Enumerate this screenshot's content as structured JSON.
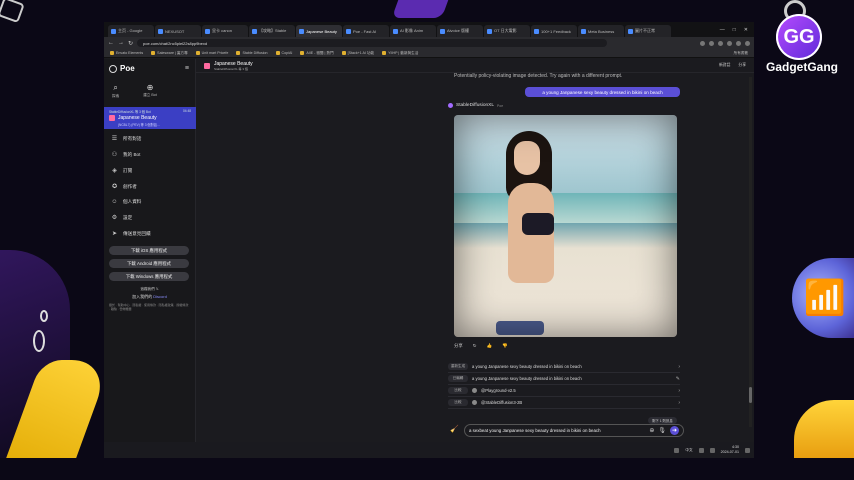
{
  "brand": {
    "logo_text": "GG",
    "name": "GadgetGang"
  },
  "browser": {
    "tabs": [
      {
        "label": "主页 - Google"
      },
      {
        "label": "NEXUSOT"
      },
      {
        "label": "显卡 canon"
      },
      {
        "label": "【攻略】Stable"
      },
      {
        "label": "Japanese Beauty",
        "active": true
      },
      {
        "label": "Poe - Fast AI"
      },
      {
        "label": "AI 影像 Anim"
      },
      {
        "label": "Aivoice 版權"
      },
      {
        "label": "OT 日大電影"
      },
      {
        "label": "100+1 Feedback"
      },
      {
        "label": "Meta Business"
      },
      {
        "label": "圖片不正常"
      }
    ],
    "window_controls": [
      "—",
      "□",
      "✕"
    ],
    "url": "poe.com/chat/2nc5plel22s8pp9bexd",
    "bookmarks": [
      "Envato Elements",
      "Salesware | 裏方專",
      "Unit mart Pricefe",
      "Stable Diffusion",
      "CopiAI",
      "AIIE - 雅聞 | 熱門",
      "[Stack+1 AI 功能",
      "YIIHP | 動新與生活"
    ],
    "bookmarks_right": "所有書籤"
  },
  "sidebar": {
    "logo": "Poe",
    "top_items": [
      {
        "icon": "search-icon",
        "label": "探索"
      },
      {
        "icon": "new-chat-icon",
        "label": "建立 Bot"
      }
    ],
    "current_bot": {
      "by": "StableDiffusionXL 等 3 個 Bot",
      "time": "04:48",
      "title": "Japanese Beauty",
      "subtitle": "(NCBL7) (PEV) 等 3 個對話..."
    },
    "links": [
      {
        "icon": "chat-icon",
        "label": "所有對話"
      },
      {
        "icon": "bot-icon",
        "label": "我的 Bot"
      },
      {
        "icon": "subscribe-icon",
        "label": "訂閱"
      },
      {
        "icon": "creator-icon",
        "label": "創作者"
      },
      {
        "icon": "profile-icon",
        "label": "個人資料"
      },
      {
        "icon": "settings-icon",
        "label": "設定"
      },
      {
        "icon": "feedback-icon",
        "label": "傳送意見回饋"
      }
    ],
    "downloads": [
      "下載 iOS 應用程式",
      "下載 Android 應用程式",
      "下載 Windows 應用程式"
    ],
    "follow": "追蹤我們",
    "join_prefix": "加入我們的",
    "join_link": "Discord",
    "legal": "關於 · 幫助中心 · 隱私權 · 使用條款 · 隱私權政策 · 授權條款 · 職缺 · 雲端機器"
  },
  "chat": {
    "header_title": "Japanese Beauty",
    "header_sub": "StableDiffusionXL 等 3 個",
    "header_actions": [
      "新對話",
      "分享"
    ],
    "policy_text": "Potentially policy-violating image detected. Try again with a different prompt.",
    "user_message": "a young Janpanese sexy beauty dressed in bikini on beach",
    "bot_name": "StableDiffusionXL",
    "bot_tag": "Poe",
    "message_actions": [
      "分享",
      "↻",
      "👍",
      "👎"
    ],
    "suggestions": [
      {
        "label": "重新生成",
        "text": "a young Janpanese sexy beauty dressed in bikini on beach"
      },
      {
        "label": "已編輯",
        "text": "a young Janpanese sexy beauty dressed in bikini on beach"
      },
      {
        "label": "比較",
        "text": "@Playground-v2.5"
      },
      {
        "label": "比較",
        "text": "@StableDiffusion3-2B"
      }
    ],
    "limit_badge": "剩下 1 則訊息",
    "composer_value": "a sexbeat young Janpanese sexy beauty dressed in bikini on beach",
    "composer_placeholder": "與 Japanese Beauty 對話"
  },
  "taskbar": {
    "tray_lang": "中文",
    "time": "4:30",
    "date": "2024-07-01"
  }
}
